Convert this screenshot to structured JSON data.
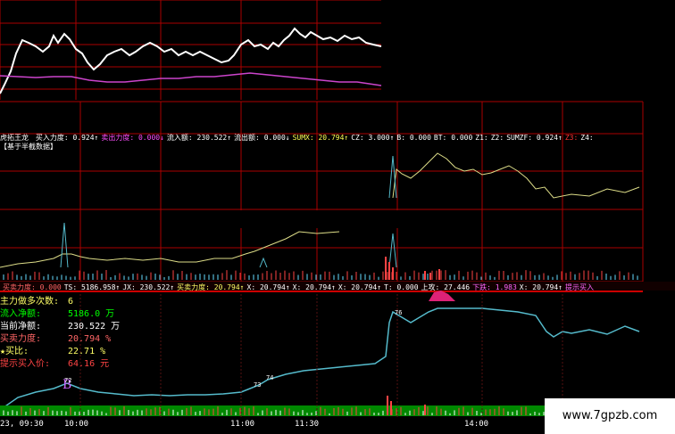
{
  "panel2_header": {
    "title": "虎拓王龙",
    "items": [
      {
        "text": "买入力度: 0.924↑",
        "color": "#ffffff"
      },
      {
        "text": "卖出力度: 0.000↓",
        "color": "#ff4fff"
      },
      {
        "text": "流入额: 230.522↑",
        "color": "#ffffff"
      },
      {
        "text": "流出额: 0.000↓",
        "color": "#ffffff"
      },
      {
        "text": "SUMX: 20.794↑",
        "color": "#ffff55"
      },
      {
        "text": "CZ: 3.000↑",
        "color": "#ffffff"
      },
      {
        "text": "B: 0.000",
        "color": "#ffffff"
      },
      {
        "text": "BT: 0.000",
        "color": "#ffffff"
      },
      {
        "text": "Z1:",
        "color": "#ffffff"
      },
      {
        "text": "Z2:",
        "color": "#ffffff"
      },
      {
        "text": "SUMZF: 0.924↑",
        "color": "#ffffff"
      },
      {
        "text": "Z3:",
        "color": "#ff3333"
      },
      {
        "text": "Z4:",
        "color": "#ffffff"
      }
    ],
    "subtitle": "【基于半截数据】"
  },
  "panel3_header": {
    "items": [
      {
        "text": "买卖力度: 0.000",
        "color": "#ff6666"
      },
      {
        "text": "TS: 5186.958↑",
        "color": "#ffffff"
      },
      {
        "text": "JX: 230.522↑",
        "color": "#ffffff"
      },
      {
        "text": "买卖力度: 20.794↑",
        "color": "#ffff66"
      },
      {
        "text": "X: 20.794↑",
        "color": "#ffffff"
      },
      {
        "text": "X: 20.794↑",
        "color": "#ffffff"
      },
      {
        "text": "X: 20.794↑",
        "color": "#ffffff"
      },
      {
        "text": "T: 0.000",
        "color": "#ffffff"
      },
      {
        "text": "上攻: 27.446",
        "color": "#ffffff"
      },
      {
        "text": "下跌: 1.983",
        "color": "#ff66ff"
      },
      {
        "text": "X: 20.794↑",
        "color": "#ffffff"
      },
      {
        "text": "提示买入",
        "color": "#ff66ff"
      }
    ]
  },
  "info": [
    {
      "label": "主力做多次数:",
      "value": "6",
      "color": "#ffff66"
    },
    {
      "label": "流入净额:",
      "value": "5186.0 万",
      "color": "#00ff00"
    },
    {
      "label": "当前净额:",
      "value": "230.522 万",
      "color": "#ffffff"
    },
    {
      "label": "买卖力度:",
      "value": "20.794 %",
      "color": "#ff6666"
    },
    {
      "label": "★买比:",
      "value": "22.71 %",
      "color": "#ffff66"
    },
    {
      "label": "提示买入价:",
      "value": "64.16 元",
      "color": "#ff4444"
    }
  ],
  "markers": {
    "m1": "B",
    "m2": "72",
    "m3": "73",
    "m4": "74",
    "m5": "76"
  },
  "time_axis": {
    "labels": [
      "23, 09:30",
      "10:00",
      "11:00",
      "11:30",
      "14:00"
    ]
  },
  "watermark": "www.7gpzb.com",
  "colors": {
    "grid": "#aa0000",
    "price": "#ffffff",
    "avg": "#cc44cc",
    "strength": "#dddd88",
    "cyan": "#55bbcc",
    "volume_up": "#ff4444",
    "volume_down": "#66ddff",
    "green_band": "#008800"
  }
}
